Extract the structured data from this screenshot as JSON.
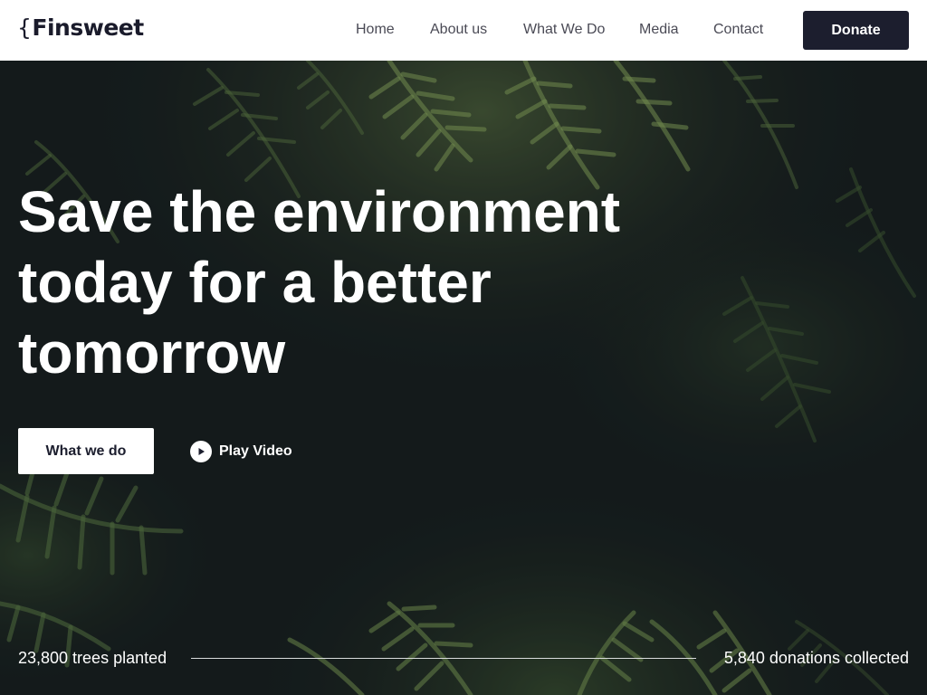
{
  "brand": {
    "brace": "{",
    "name": "Finsweet"
  },
  "nav": {
    "items": [
      "Home",
      "About us",
      "What We Do",
      "Media",
      "Contact"
    ],
    "donate_label": "Donate"
  },
  "hero": {
    "headline": "Save the environment today for a better tomorrow",
    "primary_cta": "What we do",
    "secondary_cta": "Play Video",
    "stats": {
      "left": "23,800 trees planted",
      "right": "5,840 donations collected"
    }
  },
  "colors": {
    "header_bg": "#ffffff",
    "navy": "#1c1e2e",
    "hero_bg": "#141a1b",
    "foliage": "#4f6e3a"
  }
}
